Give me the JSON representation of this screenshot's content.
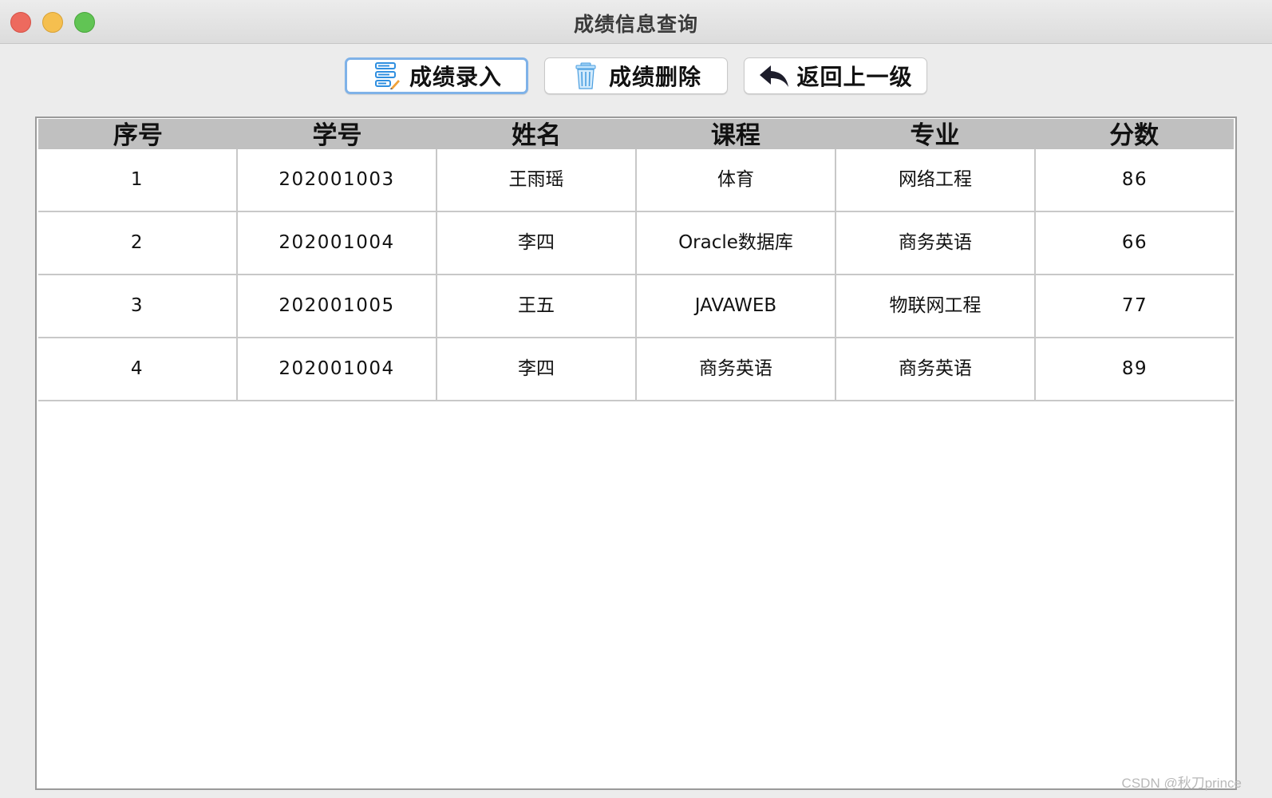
{
  "window": {
    "title": "成绩信息查询"
  },
  "toolbar": {
    "add_label": "成绩录入",
    "delete_label": "成绩删除",
    "back_label": "返回上一级",
    "accent": "#7fb2e8"
  },
  "table": {
    "headers": [
      "序号",
      "学号",
      "姓名",
      "课程",
      "专业",
      "分数"
    ],
    "header_bg": "#c0c0c0",
    "rows": [
      [
        "1",
        "202001003",
        "王雨瑶",
        "体育",
        "网络工程",
        "86"
      ],
      [
        "2",
        "202001004",
        "李四",
        "Oracle数据库",
        "商务英语",
        "66"
      ],
      [
        "3",
        "202001005",
        "王五",
        "JAVAWEB",
        "物联网工程",
        "77"
      ],
      [
        "4",
        "202001004",
        "李四",
        "商务英语",
        "商务英语",
        "89"
      ]
    ]
  },
  "icons": {
    "add": "form-edit-icon",
    "delete": "trash-icon",
    "back": "reply-arrow-icon"
  },
  "watermark": "CSDN @秋刀prince"
}
